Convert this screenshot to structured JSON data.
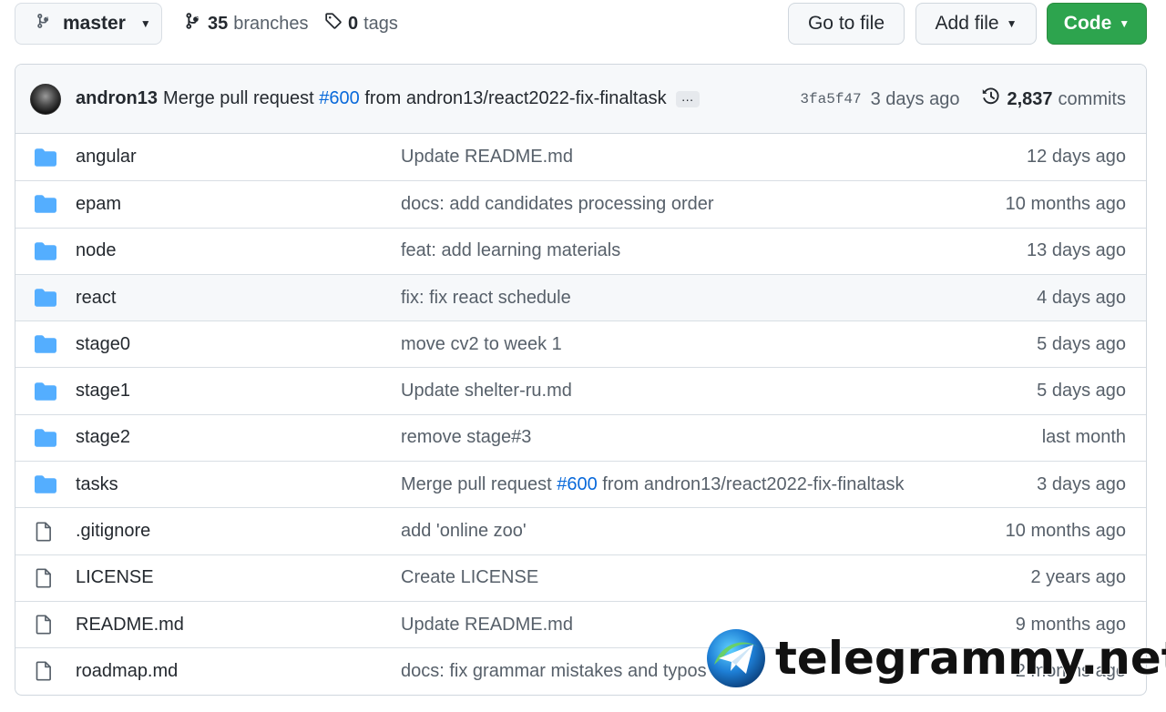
{
  "toolbar": {
    "branch": "master",
    "branches_count": "35",
    "branches_label": "branches",
    "tags_count": "0",
    "tags_label": "tags",
    "go_to_file": "Go to file",
    "add_file": "Add file",
    "code": "Code"
  },
  "commit": {
    "author": "andron13",
    "message_before": "Merge pull request",
    "pr": "#600",
    "message_after": "from andron13/react2022-fix-finaltask",
    "ellipsis": "…",
    "sha": "3fa5f47",
    "time": "3 days ago",
    "commits_count": "2,837",
    "commits_label": "commits"
  },
  "files": [
    {
      "type": "dir",
      "name": "angular",
      "message": "Update README.md",
      "age": "12 days ago"
    },
    {
      "type": "dir",
      "name": "epam",
      "message": "docs: add candidates processing order",
      "age": "10 months ago"
    },
    {
      "type": "dir",
      "name": "node",
      "message": "feat: add learning materials",
      "age": "13 days ago"
    },
    {
      "type": "dir",
      "name": "react",
      "message": "fix: fix react schedule",
      "age": "4 days ago"
    },
    {
      "type": "dir",
      "name": "stage0",
      "message": "move cv2 to week 1",
      "age": "5 days ago"
    },
    {
      "type": "dir",
      "name": "stage1",
      "message": "Update shelter-ru.md",
      "age": "5 days ago"
    },
    {
      "type": "dir",
      "name": "stage2",
      "message": "remove stage#3",
      "age": "last month"
    },
    {
      "type": "dir",
      "name": "tasks",
      "message": "Merge pull request",
      "message_pr": "#600",
      "message_after": "from andron13/react2022-fix-finaltask",
      "age": "3 days ago"
    },
    {
      "type": "file",
      "name": ".gitignore",
      "message": "add 'online zoo'",
      "age": "10 months ago"
    },
    {
      "type": "file",
      "name": "LICENSE",
      "message": "Create LICENSE",
      "age": "2 years ago"
    },
    {
      "type": "file",
      "name": "README.md",
      "message": "Update README.md",
      "age": "9 months ago"
    },
    {
      "type": "file",
      "name": "roadmap.md",
      "message": "docs: fix grammar mistakes and typos",
      "age": "2 months ago"
    }
  ],
  "watermark": {
    "text": "telegrammy.net"
  },
  "colors": {
    "accent_green": "#2da44e",
    "link_blue": "#0969da",
    "folder_blue": "#54aeff",
    "muted": "#57606a"
  },
  "icons": {
    "branch": "git-branch-icon",
    "tag": "tag-icon",
    "history": "history-icon",
    "folder": "folder-icon",
    "file": "file-icon",
    "caret": "triangle-down-icon"
  }
}
